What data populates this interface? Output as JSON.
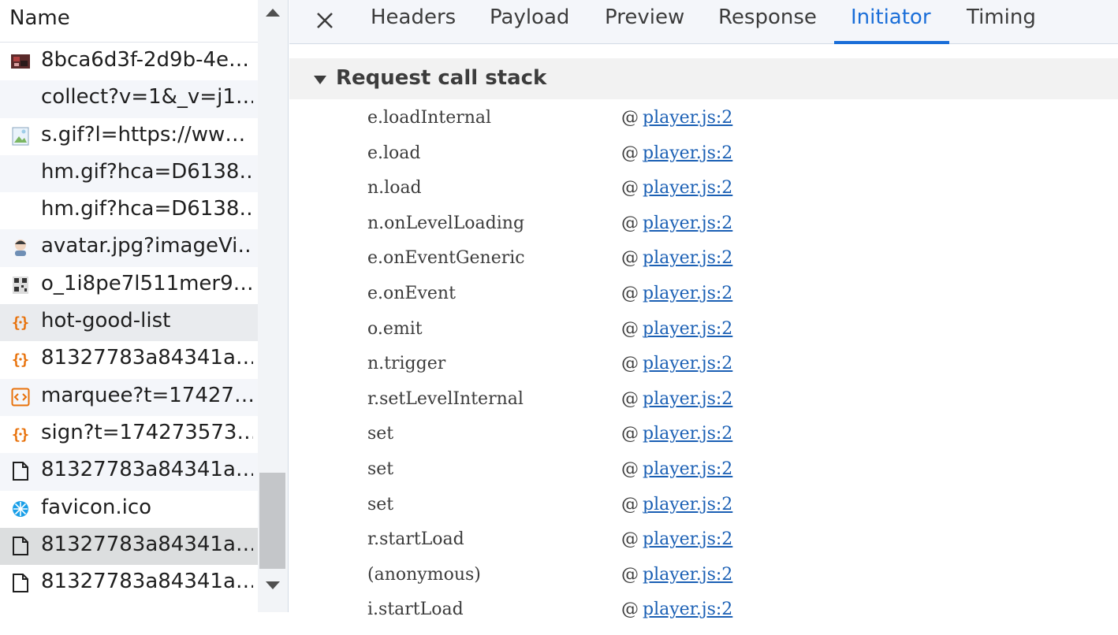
{
  "list": {
    "header": "Name",
    "rows": [
      {
        "label": "8bca6d3f-2d9b-4e…",
        "icon": "image-thumbnail-icon",
        "state": "normal"
      },
      {
        "label": "collect?v=1&_v=j1…",
        "icon": "",
        "state": "normal"
      },
      {
        "label": "s.gif?l=https://ww…",
        "icon": "image-file-icon",
        "state": "normal"
      },
      {
        "label": "hm.gif?hca=D6138…",
        "icon": "",
        "state": "normal"
      },
      {
        "label": "hm.gif?hca=D6138…",
        "icon": "",
        "state": "normal"
      },
      {
        "label": "avatar.jpg?imageVi…",
        "icon": "avatar-image-icon",
        "state": "normal"
      },
      {
        "label": "o_1i8pe7l511mer9…",
        "icon": "qr-image-icon",
        "state": "normal"
      },
      {
        "label": "hot-good-list",
        "icon": "json-braces-icon",
        "state": "hover"
      },
      {
        "label": "81327783a84341a…",
        "icon": "json-braces-icon",
        "state": "normal"
      },
      {
        "label": "marquee?t=17427…",
        "icon": "script-brackets-icon",
        "state": "normal"
      },
      {
        "label": "sign?t=174273573…",
        "icon": "json-braces-icon",
        "state": "normal"
      },
      {
        "label": "81327783a84341a…",
        "icon": "document-icon",
        "state": "normal"
      },
      {
        "label": "favicon.ico",
        "icon": "favicon-icon",
        "state": "normal"
      },
      {
        "label": "81327783a84341a…",
        "icon": "document-icon",
        "state": "selected"
      },
      {
        "label": "81327783a84341a…",
        "icon": "document-icon",
        "state": "normal"
      }
    ]
  },
  "tabs": {
    "items": [
      "Headers",
      "Payload",
      "Preview",
      "Response",
      "Initiator",
      "Timing"
    ],
    "active": "Initiator"
  },
  "initiator": {
    "section_title": "Request call stack",
    "frames": [
      {
        "fn": "e.loadInternal",
        "link": "player.js:2"
      },
      {
        "fn": "e.load",
        "link": "player.js:2"
      },
      {
        "fn": "n.load",
        "link": "player.js:2"
      },
      {
        "fn": "n.onLevelLoading",
        "link": "player.js:2"
      },
      {
        "fn": "e.onEventGeneric",
        "link": "player.js:2"
      },
      {
        "fn": "e.onEvent",
        "link": "player.js:2"
      },
      {
        "fn": "o.emit",
        "link": "player.js:2"
      },
      {
        "fn": "n.trigger",
        "link": "player.js:2"
      },
      {
        "fn": "r.setLevelInternal",
        "link": "player.js:2"
      },
      {
        "fn": "set",
        "link": "player.js:2"
      },
      {
        "fn": "set",
        "link": "player.js:2"
      },
      {
        "fn": "set",
        "link": "player.js:2"
      },
      {
        "fn": "r.startLoad",
        "link": "player.js:2"
      },
      {
        "fn": "(anonymous)",
        "link": "player.js:2"
      },
      {
        "fn": "i.startLoad",
        "link": "player.js:2"
      }
    ],
    "at_symbol": "@"
  },
  "colors": {
    "accent": "#1a6ed8",
    "link": "#1a5fb4",
    "json_icon": "#e8710a",
    "favicon": "#1a9fe8"
  }
}
